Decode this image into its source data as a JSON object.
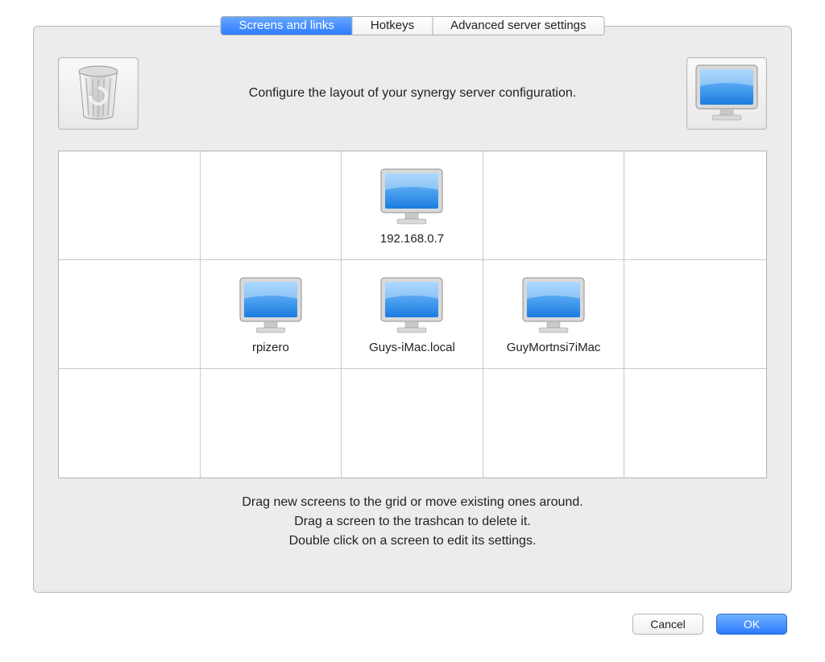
{
  "tabs": {
    "screens": "Screens and links",
    "hotkeys": "Hotkeys",
    "advanced": "Advanced server settings"
  },
  "header_instruction": "Configure the layout of your synergy server configuration.",
  "screens": {
    "top_middle": "192.168.0.7",
    "mid_left": "rpizero",
    "mid_center": "Guys-iMac.local",
    "mid_right": "GuyMortnsi7iMac"
  },
  "footer": {
    "line1": "Drag new screens to the grid or move existing ones around.",
    "line2": "Drag a screen to the trashcan to delete it.",
    "line3": "Double click on a screen to edit its settings."
  },
  "buttons": {
    "cancel": "Cancel",
    "ok": "OK"
  }
}
